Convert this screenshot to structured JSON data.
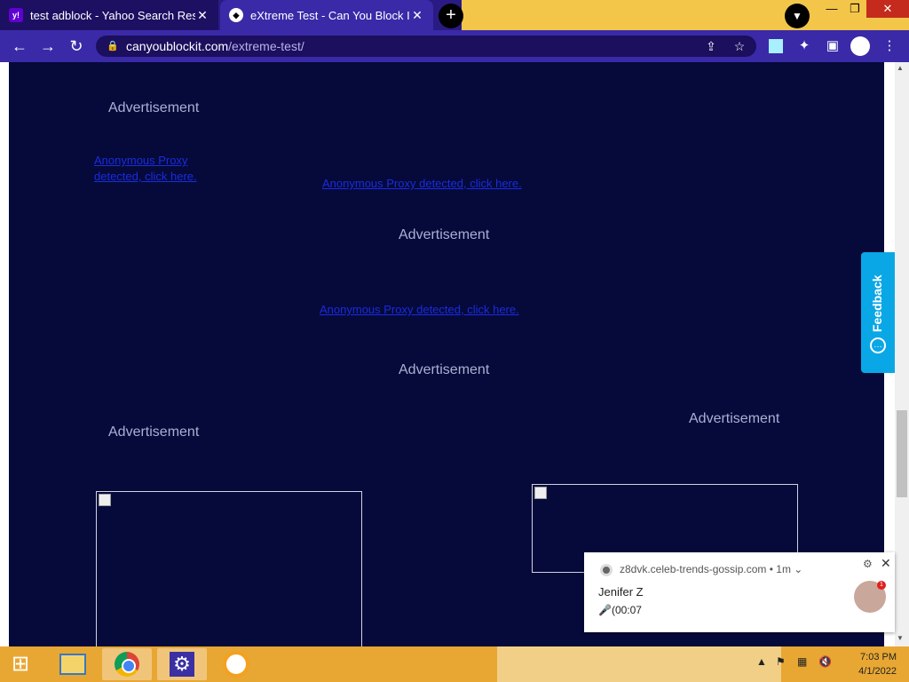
{
  "tabs": [
    {
      "title": "test adblock - Yahoo Search Resu",
      "favicon": "yahoo-icon",
      "active": false
    },
    {
      "title": "eXtreme Test - Can You Block It ?",
      "favicon": "shield-icon",
      "active": true
    }
  ],
  "address_bar": {
    "domain": "canyoublockit.com",
    "path": "/extreme-test/"
  },
  "page": {
    "ad_labels": [
      "Advertisement",
      "Advertisement",
      "Advertisement",
      "Advertisement",
      "Advertisement"
    ],
    "links": [
      "Anonymous Proxy detected, click here.",
      "Anonymous Proxy detected, click here.",
      "Anonymous Proxy detected, click here."
    ],
    "feedback_label": "Feedback"
  },
  "notification": {
    "source": "z8dvk.celeb-trends-gossip.com",
    "age": "1m",
    "title": "Jenifer Z",
    "body": "🎤(00:07",
    "badge": "1"
  },
  "taskbar": {
    "time": "7:03 PM",
    "date": "4/1/2022"
  },
  "colors": {
    "page_bg": "#050a3a",
    "browser_frame": "#3a2aa8",
    "link": "#1b2bdf",
    "ad_text": "#a9b0d4",
    "feedback": "#0aa7e6",
    "taskbar": "#e8a733"
  }
}
